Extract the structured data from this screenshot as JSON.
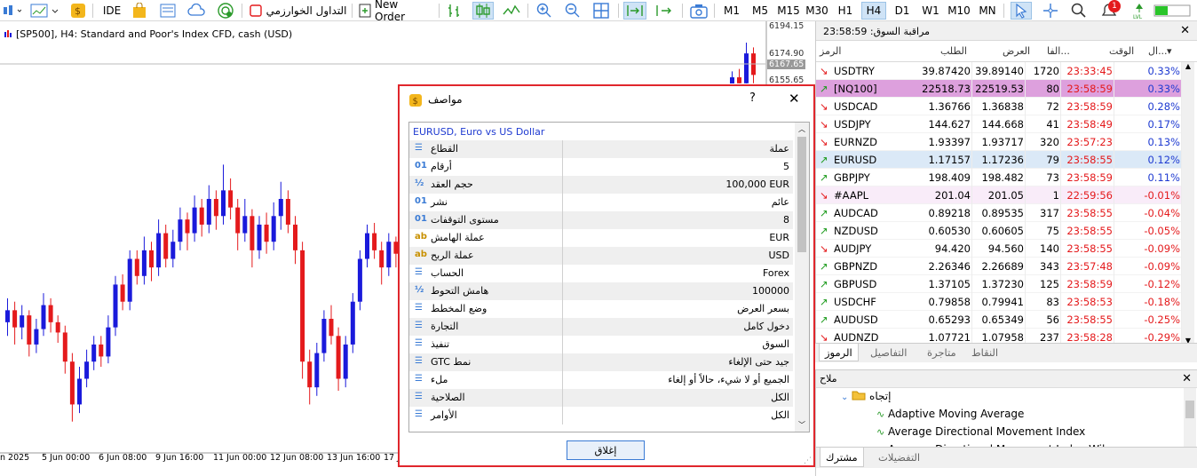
{
  "toolbar": {
    "ide": "IDE",
    "algo_trading": "التداول الخوارزمي",
    "new_order": "New Order",
    "timeframes": [
      "M1",
      "M5",
      "M15",
      "M30",
      "H1",
      "H4",
      "D1",
      "W1",
      "M10",
      "MN"
    ],
    "active_timeframe": "H4",
    "notification_count": "1"
  },
  "chart": {
    "title": "[SP500], H4:  Standard and Poor's Index CFD, cash (USD)",
    "price_labels": [
      "6194.15",
      "6174.90",
      "6167.65",
      "6155.65"
    ],
    "time_labels": [
      "n 2025",
      "5 Jun 00:00",
      "6 Jun 08:00",
      "9 Jun 16:00",
      "11 Jun 00:00",
      "12 Jun 08:00",
      "13 Jun 16:00",
      "17 J"
    ],
    "candles": [
      {
        "o": 6008,
        "c": 6015,
        "h": 6022,
        "l": 6000
      },
      {
        "o": 6015,
        "c": 6005,
        "h": 6020,
        "l": 5995
      },
      {
        "o": 6005,
        "c": 6012,
        "h": 6018,
        "l": 5998
      },
      {
        "o": 6012,
        "c": 5995,
        "h": 6015,
        "l": 5988
      },
      {
        "o": 5995,
        "c": 6004,
        "h": 6010,
        "l": 5990
      },
      {
        "o": 6004,
        "c": 6018,
        "h": 6025,
        "l": 6000
      },
      {
        "o": 6018,
        "c": 6008,
        "h": 6022,
        "l": 6002
      },
      {
        "o": 6008,
        "c": 6002,
        "h": 6012,
        "l": 5996
      },
      {
        "o": 6002,
        "c": 5985,
        "h": 6006,
        "l": 5978
      },
      {
        "o": 5985,
        "c": 5960,
        "h": 5990,
        "l": 5950
      },
      {
        "o": 5960,
        "c": 5975,
        "h": 5982,
        "l": 5955
      },
      {
        "o": 5975,
        "c": 5985,
        "h": 5992,
        "l": 5970
      },
      {
        "o": 5985,
        "c": 5995,
        "h": 6000,
        "l": 5980
      },
      {
        "o": 5995,
        "c": 5988,
        "h": 6000,
        "l": 5982
      },
      {
        "o": 5988,
        "c": 6005,
        "h": 6012,
        "l": 5984
      },
      {
        "o": 6005,
        "c": 6030,
        "h": 6035,
        "l": 6000
      },
      {
        "o": 6030,
        "c": 6020,
        "h": 6036,
        "l": 6015
      },
      {
        "o": 6020,
        "c": 6045,
        "h": 6050,
        "l": 6015
      },
      {
        "o": 6045,
        "c": 6035,
        "h": 6050,
        "l": 6030
      },
      {
        "o": 6035,
        "c": 6050,
        "h": 6058,
        "l": 6030
      },
      {
        "o": 6050,
        "c": 6040,
        "h": 6055,
        "l": 6032
      },
      {
        "o": 6040,
        "c": 6060,
        "h": 6068,
        "l": 6035
      },
      {
        "o": 6060,
        "c": 6045,
        "h": 6065,
        "l": 6040
      },
      {
        "o": 6045,
        "c": 6055,
        "h": 6062,
        "l": 6040
      },
      {
        "o": 6055,
        "c": 6068,
        "h": 6075,
        "l": 6050
      },
      {
        "o": 6068,
        "c": 6060,
        "h": 6072,
        "l": 6050
      },
      {
        "o": 6060,
        "c": 6075,
        "h": 6082,
        "l": 6055
      },
      {
        "o": 6075,
        "c": 6065,
        "h": 6080,
        "l": 6058
      },
      {
        "o": 6065,
        "c": 6080,
        "h": 6088,
        "l": 6060
      },
      {
        "o": 6080,
        "c": 6070,
        "h": 6085,
        "l": 6062
      },
      {
        "o": 6070,
        "c": 6085,
        "h": 6100,
        "l": 6065
      },
      {
        "o": 6085,
        "c": 6075,
        "h": 6092,
        "l": 6068
      },
      {
        "o": 6075,
        "c": 6060,
        "h": 6080,
        "l": 6050
      },
      {
        "o": 6060,
        "c": 6070,
        "h": 6080,
        "l": 6055
      },
      {
        "o": 6070,
        "c": 6050,
        "h": 6074,
        "l": 6040
      },
      {
        "o": 6050,
        "c": 6065,
        "h": 6070,
        "l": 6045
      },
      {
        "o": 6065,
        "c": 6055,
        "h": 6072,
        "l": 6048
      },
      {
        "o": 6055,
        "c": 6070,
        "h": 6078,
        "l": 6050
      },
      {
        "o": 6070,
        "c": 6080,
        "h": 6090,
        "l": 6062
      },
      {
        "o": 6080,
        "c": 6065,
        "h": 6085,
        "l": 6060
      },
      {
        "o": 6065,
        "c": 6050,
        "h": 6070,
        "l": 6042
      },
      {
        "o": 6050,
        "c": 5985,
        "h": 6055,
        "l": 5975
      },
      {
        "o": 5985,
        "c": 5970,
        "h": 5992,
        "l": 5960
      },
      {
        "o": 5970,
        "c": 5990,
        "h": 5996,
        "l": 5965
      },
      {
        "o": 5990,
        "c": 6010,
        "h": 6015,
        "l": 5985
      },
      {
        "o": 6010,
        "c": 6000,
        "h": 6018,
        "l": 5995
      },
      {
        "o": 6000,
        "c": 5975,
        "h": 6005,
        "l": 5968
      },
      {
        "o": 5975,
        "c": 5995,
        "h": 6000,
        "l": 5970
      },
      {
        "o": 5995,
        "c": 6020,
        "h": 6025,
        "l": 5990
      },
      {
        "o": 6020,
        "c": 6045,
        "h": 6050,
        "l": 6015
      },
      {
        "o": 6045,
        "c": 6060,
        "h": 6065,
        "l": 6040
      },
      {
        "o": 6060,
        "c": 6050,
        "h": 6066,
        "l": 6045
      },
      {
        "o": 6050,
        "c": 6040,
        "h": 6055,
        "l": 6030
      },
      {
        "o": 6040,
        "c": 6055,
        "h": 6060,
        "l": 6035
      },
      {
        "o": 6055,
        "c": 6048,
        "h": 6058,
        "l": 6040
      }
    ],
    "recent_candles": [
      {
        "o": 6150,
        "c": 6165,
        "h": 6170,
        "l": 6145
      },
      {
        "o": 6165,
        "c": 6160,
        "h": 6172,
        "l": 6150
      },
      {
        "o": 6160,
        "c": 6185,
        "h": 6194,
        "l": 6155
      },
      {
        "o": 6185,
        "c": 6167,
        "h": 6190,
        "l": 6160
      }
    ]
  },
  "market_watch": {
    "title": "مراقبة السوق: 23:58:59",
    "columns": {
      "symbol": "الرمز",
      "bid": "الطلب",
      "ask": "العرض",
      "spread": "الفا...",
      "time": "الوقت",
      "change": "ال..."
    },
    "rows": [
      {
        "symbol": "USDTRY",
        "bid": "39.87420",
        "ask": "39.89140",
        "spread": "1720",
        "time": "23:33:45",
        "change": "0.33%",
        "dir": "down"
      },
      {
        "symbol": "[NQ100]",
        "bid": "22518.73",
        "ask": "22519.53",
        "spread": "80",
        "time": "23:58:59",
        "change": "0.33%",
        "dir": "up",
        "highlight": "#dda0dd"
      },
      {
        "symbol": "USDCAD",
        "bid": "1.36766",
        "ask": "1.36838",
        "spread": "72",
        "time": "23:58:59",
        "change": "0.28%",
        "dir": "down"
      },
      {
        "symbol": "USDJPY",
        "bid": "144.627",
        "ask": "144.668",
        "spread": "41",
        "time": "23:58:49",
        "change": "0.17%",
        "dir": "down"
      },
      {
        "symbol": "EURNZD",
        "bid": "1.93397",
        "ask": "1.93717",
        "spread": "320",
        "time": "23:57:23",
        "change": "0.13%",
        "dir": "down"
      },
      {
        "symbol": "EURUSD",
        "bid": "1.17157",
        "ask": "1.17236",
        "spread": "79",
        "time": "23:58:55",
        "change": "0.12%",
        "dir": "up",
        "highlight": "#dbe9f7"
      },
      {
        "symbol": "GBPJPY",
        "bid": "198.409",
        "ask": "198.482",
        "spread": "73",
        "time": "23:58:59",
        "change": "0.11%",
        "dir": "up"
      },
      {
        "symbol": "#AAPL",
        "bid": "201.04",
        "ask": "201.05",
        "spread": "1",
        "time": "22:59:56",
        "change": "-0.01%",
        "dir": "down",
        "highlight": "#f9ecf9"
      },
      {
        "symbol": "AUDCAD",
        "bid": "0.89218",
        "ask": "0.89535",
        "spread": "317",
        "time": "23:58:55",
        "change": "-0.04%",
        "dir": "up"
      },
      {
        "symbol": "NZDUSD",
        "bid": "0.60530",
        "ask": "0.60605",
        "spread": "75",
        "time": "23:58:55",
        "change": "-0.05%",
        "dir": "up"
      },
      {
        "symbol": "AUDJPY",
        "bid": "94.420",
        "ask": "94.560",
        "spread": "140",
        "time": "23:58:55",
        "change": "-0.09%",
        "dir": "down"
      },
      {
        "symbol": "GBPNZD",
        "bid": "2.26346",
        "ask": "2.26689",
        "spread": "343",
        "time": "23:57:48",
        "change": "-0.09%",
        "dir": "up"
      },
      {
        "symbol": "GBPUSD",
        "bid": "1.37105",
        "ask": "1.37230",
        "spread": "125",
        "time": "23:58:59",
        "change": "-0.12%",
        "dir": "up"
      },
      {
        "symbol": "USDCHF",
        "bid": "0.79858",
        "ask": "0.79941",
        "spread": "83",
        "time": "23:58:53",
        "change": "-0.18%",
        "dir": "up"
      },
      {
        "symbol": "AUDUSD",
        "bid": "0.65293",
        "ask": "0.65349",
        "spread": "56",
        "time": "23:58:55",
        "change": "-0.25%",
        "dir": "up"
      },
      {
        "symbol": "AUDNZD",
        "bid": "1.07721",
        "ask": "1.07958",
        "spread": "237",
        "time": "23:58:28",
        "change": "-0.29%",
        "dir": "down"
      }
    ],
    "tabs": [
      "الرموز",
      "التفاصيل",
      "متاجرة",
      "النقاط"
    ],
    "active_tab": "الرموز"
  },
  "navigator": {
    "title": "ملاح",
    "folder": "إتجاه",
    "items": [
      "Adaptive Moving Average",
      "Average Directional Movement Index",
      "Average Directional Movement Index Wilder"
    ],
    "tabs": [
      "مشترك",
      "التفضيلات"
    ]
  },
  "dialog": {
    "title": "مواصف",
    "help": "?",
    "symbol_header": "EURUSD, Euro vs US Dollar",
    "close_button": "إغلاق",
    "properties": [
      {
        "icon": "list",
        "key": "القطاع",
        "value": "عملة"
      },
      {
        "icon": "01",
        "key": "أرقام",
        "value": "5"
      },
      {
        "icon": "half",
        "key": "حجم العقد",
        "value": "100,000 EUR"
      },
      {
        "icon": "01",
        "key": "نشر",
        "value": "عائم"
      },
      {
        "icon": "01",
        "key": "مستوى التوقفات",
        "value": "8"
      },
      {
        "icon": "ab",
        "key": "عملة الهامش",
        "value": "EUR"
      },
      {
        "icon": "ab",
        "key": "عملة الربح",
        "value": "USD"
      },
      {
        "icon": "list",
        "key": "الحساب",
        "value": "Forex"
      },
      {
        "icon": "half",
        "key": "هامش التحوط",
        "value": "100000"
      },
      {
        "icon": "list",
        "key": "وضع المخطط",
        "value": "بسعر العرض"
      },
      {
        "icon": "list",
        "key": "التجارة",
        "value": "دخول كامل"
      },
      {
        "icon": "list",
        "key": "تنفيذ",
        "value": "السوق"
      },
      {
        "icon": "list",
        "key": "نمط GTC",
        "value": "جيد حتى الإلغاء"
      },
      {
        "icon": "list",
        "key": "ملء",
        "value": "الجميع أو لا شيء، حالاً أو إلغاء"
      },
      {
        "icon": "list",
        "key": "الصلاحية",
        "value": "الكل"
      },
      {
        "icon": "list",
        "key": "الأوامر",
        "value": "الكل"
      }
    ]
  },
  "colors": {
    "bull": "#1a1adb",
    "bear": "#e41a1c",
    "up_arrow": "#1a9a1a",
    "down_arrow": "#e41a1c",
    "time_text": "#e41a1c",
    "pos_change": "#1f3bd1",
    "neg_change": "#e41a1c"
  }
}
